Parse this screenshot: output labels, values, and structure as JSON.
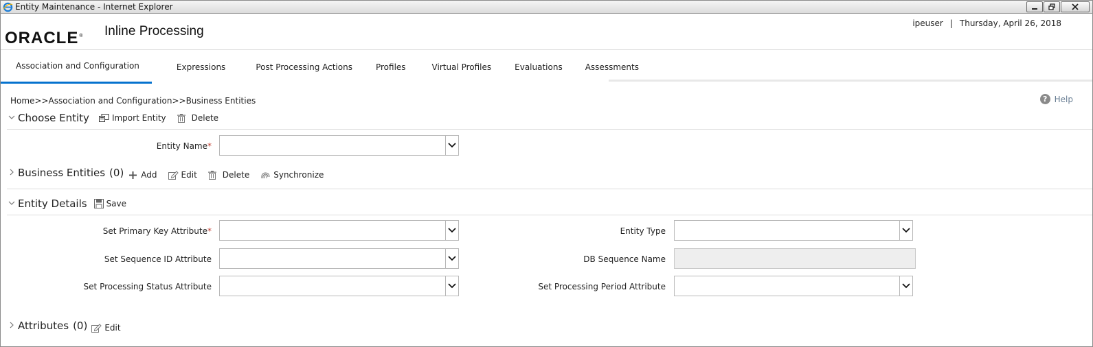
{
  "window": {
    "title": "Entity Maintenance - Internet Explorer"
  },
  "header": {
    "brand": "ORACLE",
    "product": "Inline Processing",
    "user": "ipeuser",
    "separator": "|",
    "date": "Thursday, April 26, 2018"
  },
  "tabs": [
    {
      "label": "Association and Configuration",
      "active": true
    },
    {
      "label": "Expressions"
    },
    {
      "label": "Post Processing Actions"
    },
    {
      "label": "Profiles"
    },
    {
      "label": "Virtual Profiles"
    },
    {
      "label": "Evaluations"
    },
    {
      "label": "Assessments"
    }
  ],
  "breadcrumb": "Home>>Association and Configuration>>Business Entities",
  "help_label": "Help",
  "choose_entity": {
    "title": "Choose Entity",
    "import_label": "Import Entity",
    "delete_label": "Delete",
    "entity_name_label": "Entity Name",
    "required_mark": "*",
    "entity_name_value": ""
  },
  "business_entities": {
    "title": "Business Entities",
    "count": "(0)",
    "add_label": "Add",
    "edit_label": "Edit",
    "delete_label": "Delete",
    "sync_label": "Synchronize"
  },
  "entity_details": {
    "title": "Entity Details",
    "save_label": "Save",
    "primary_key_label": "Set Primary Key Attribute",
    "sequence_id_label": "Set Sequence ID Attribute",
    "processing_status_label": "Set Processing Status Attribute",
    "entity_type_label": "Entity Type",
    "db_sequence_label": "DB Sequence Name",
    "processing_period_label": "Set Processing Period Attribute"
  },
  "attributes": {
    "title": "Attributes",
    "count": "(0)",
    "edit_label": "Edit"
  },
  "colors": {
    "active_tab_underline": "#0572ce",
    "required": "#c0392b",
    "help_text": "#6a7f94"
  }
}
